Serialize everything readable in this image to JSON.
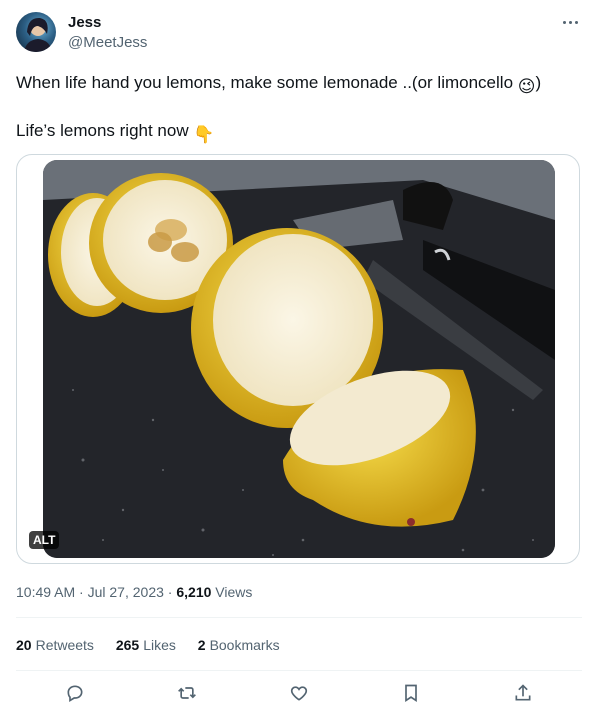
{
  "author": {
    "name": "Jess",
    "handle": "@MeetJess"
  },
  "tweet": {
    "line1_text": "When life hand you lemons, make some lemonade ..(or limoncello ",
    "line1_emoji": "😉",
    "line1_suffix": ")",
    "line2_text": "Life’s lemons right now ",
    "line2_emoji": "👇"
  },
  "media": {
    "alt_badge": "ALT"
  },
  "meta": {
    "time": "10:49 AM",
    "date": "Jul 27, 2023",
    "views_count": "6,210",
    "views_label": "Views",
    "separator": " · "
  },
  "stats": {
    "retweets_count": "20",
    "retweets_label": "Retweets",
    "likes_count": "265",
    "likes_label": "Likes",
    "bookmarks_count": "2",
    "bookmarks_label": "Bookmarks"
  },
  "actions": [
    "reply-icon",
    "retweet-icon",
    "like-icon",
    "bookmark-icon",
    "share-icon"
  ],
  "colors": {
    "text": "#0f1419",
    "secondary": "#536471",
    "border": "#cfd9de"
  }
}
